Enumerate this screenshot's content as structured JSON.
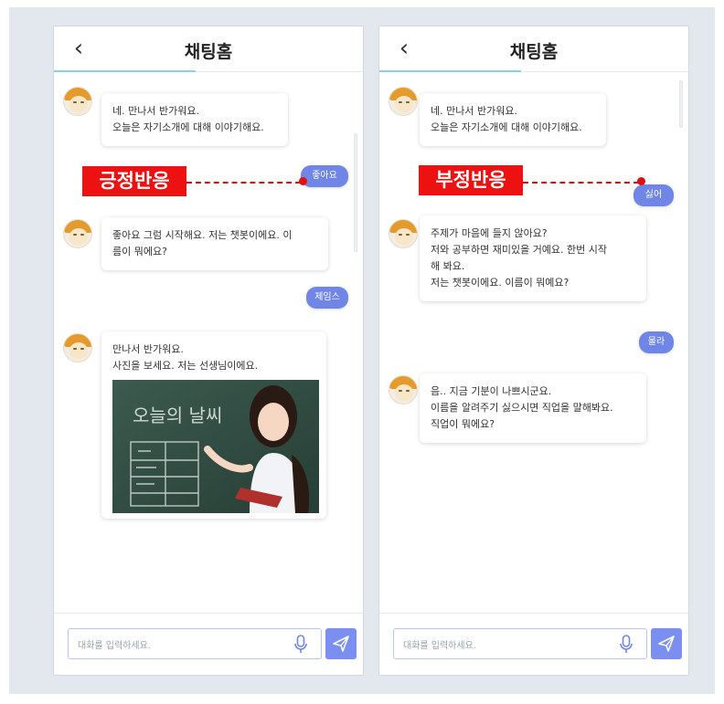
{
  "screens": [
    {
      "header": {
        "title": "채팅홈",
        "back_icon": "chevron-left-icon"
      },
      "annotation": {
        "label": "긍정반응"
      },
      "messages": {
        "bot1": {
          "line1": "네. 만나서 반가워요.",
          "line2": "오늘은 자기소개에 대해 이야기해요."
        },
        "user1": "좋아요",
        "bot2": {
          "line1": "좋아요 그럼 시작해요. 저는 챗봇이에요. 이",
          "line2": "름이 뭐에요?"
        },
        "user2": "제임스",
        "bot3": {
          "line1": "만나서 반가워요.",
          "line2": "사진을 보세요. 저는 선생님이에요.",
          "image_text": "오늘의 날씨"
        }
      },
      "input": {
        "placeholder": "대화를 입력하세요.",
        "mic_icon": "microphone-icon",
        "send_icon": "send-icon"
      }
    },
    {
      "header": {
        "title": "채팅홈",
        "back_icon": "chevron-left-icon"
      },
      "annotation": {
        "label": "부정반응"
      },
      "messages": {
        "bot1": {
          "line1": "네. 만나서 반가워요.",
          "line2": "오늘은 자기소개에 대해 이야기해요."
        },
        "user1": "싫어",
        "bot2": {
          "line1": "주제가 마음에 들지 않아요?",
          "line2": "저와 공부하면 재미있을 거예요. 한번 시작",
          "line3": "해 봐요.",
          "line4": "저는 챗봇이에요. 이름이 뭐예요?"
        },
        "user2": "몰라",
        "bot3": {
          "line1": "음.. 지금 기분이 나쁘시군요.",
          "line2": "이름을 알려주기 싫으시면 직업을 말해봐요.",
          "line3": "직업이 뭐에요?"
        }
      },
      "input": {
        "placeholder": "대화를 입력하세요.",
        "mic_icon": "microphone-icon",
        "send_icon": "send-icon"
      }
    }
  ],
  "colors": {
    "background": "#e3e7ee",
    "user_bubble": "#6f86e6",
    "send_button": "#7b8ff0",
    "annotation_red": "#ee1111",
    "header_underline": "#8fd0dc"
  }
}
